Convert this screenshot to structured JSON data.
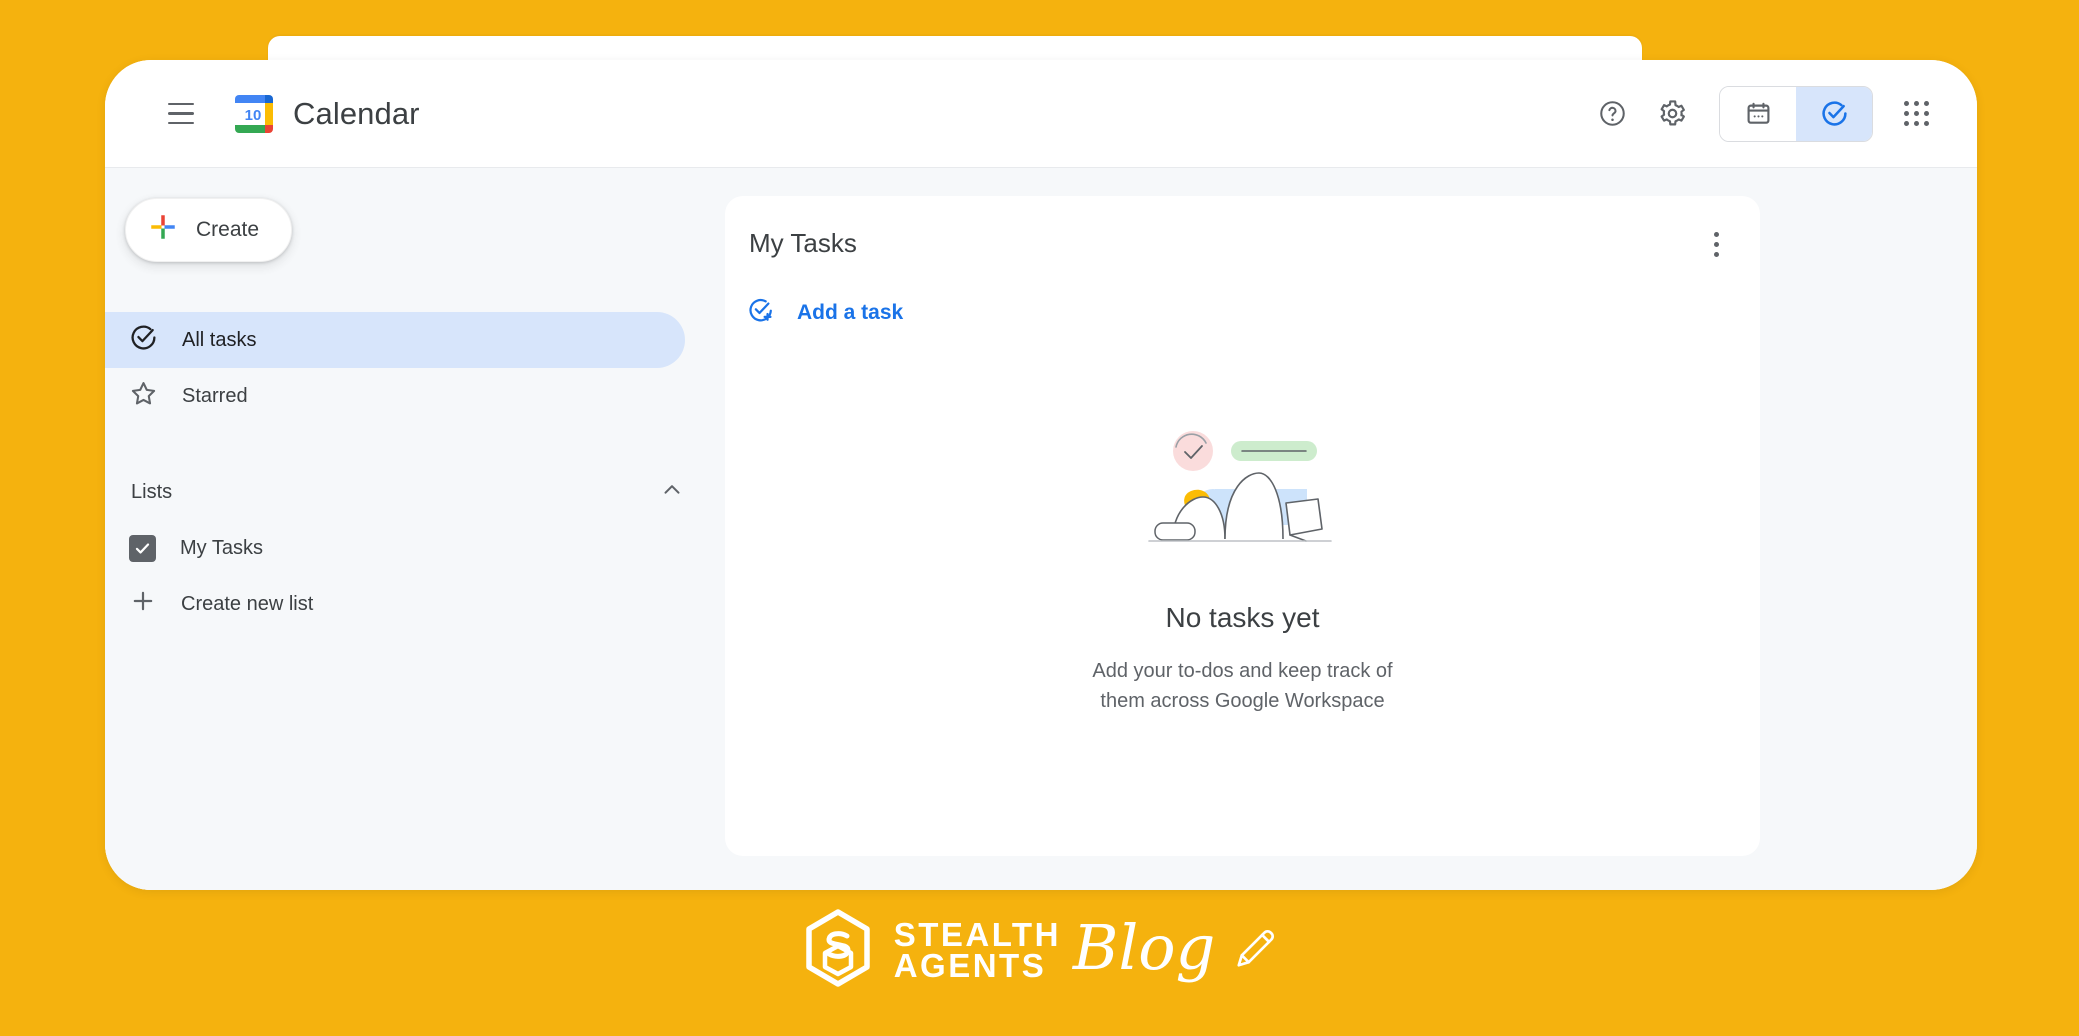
{
  "theme": {
    "page_background": "#F5B20E",
    "accent_blue": "#1a73e8",
    "active_pill": "#d7e5fb",
    "text_primary": "#3c4043",
    "text_secondary": "#5f6368",
    "card_background": "#ffffff",
    "app_background": "#f6f8fa"
  },
  "header": {
    "menu_icon": "hamburger-menu-icon",
    "logo_icon": "google-calendar-logo",
    "logo_day": "10",
    "title": "Calendar",
    "help_icon": "help-circle-icon",
    "settings_icon": "gear-icon",
    "toggle": {
      "calendar_icon": "calendar-icon",
      "tasks_icon": "task-check-circle-icon",
      "active": "tasks"
    },
    "apps_icon": "apps-grid-icon"
  },
  "sidebar": {
    "create": {
      "label": "Create",
      "icon": "google-plus-icon"
    },
    "nav": [
      {
        "label": "All tasks",
        "icon": "check-circle-icon",
        "active": true
      },
      {
        "label": "Starred",
        "icon": "star-outline-icon",
        "active": false
      }
    ],
    "lists_section": {
      "label": "Lists",
      "collapse_icon": "chevron-up-icon",
      "items": [
        {
          "label": "My Tasks",
          "icon": "checkbox-checked-icon"
        },
        {
          "label": "Create new list",
          "icon": "plus-icon"
        }
      ]
    }
  },
  "main": {
    "card_title": "My Tasks",
    "overflow_icon": "more-vertical-icon",
    "add_task": {
      "label": "Add a task",
      "icon": "add-task-icon"
    },
    "empty_state": {
      "illustration": "no-tasks-illustration",
      "title": "No tasks yet",
      "subtitle": "Add your to-dos and keep track of them across Google Workspace"
    }
  },
  "footer": {
    "logo_icon": "stealth-agents-hexagon-logo",
    "word_top": "STEALTH",
    "word_bottom": "AGENTS",
    "script": "Blog",
    "pen_icon": "pen-icon"
  }
}
